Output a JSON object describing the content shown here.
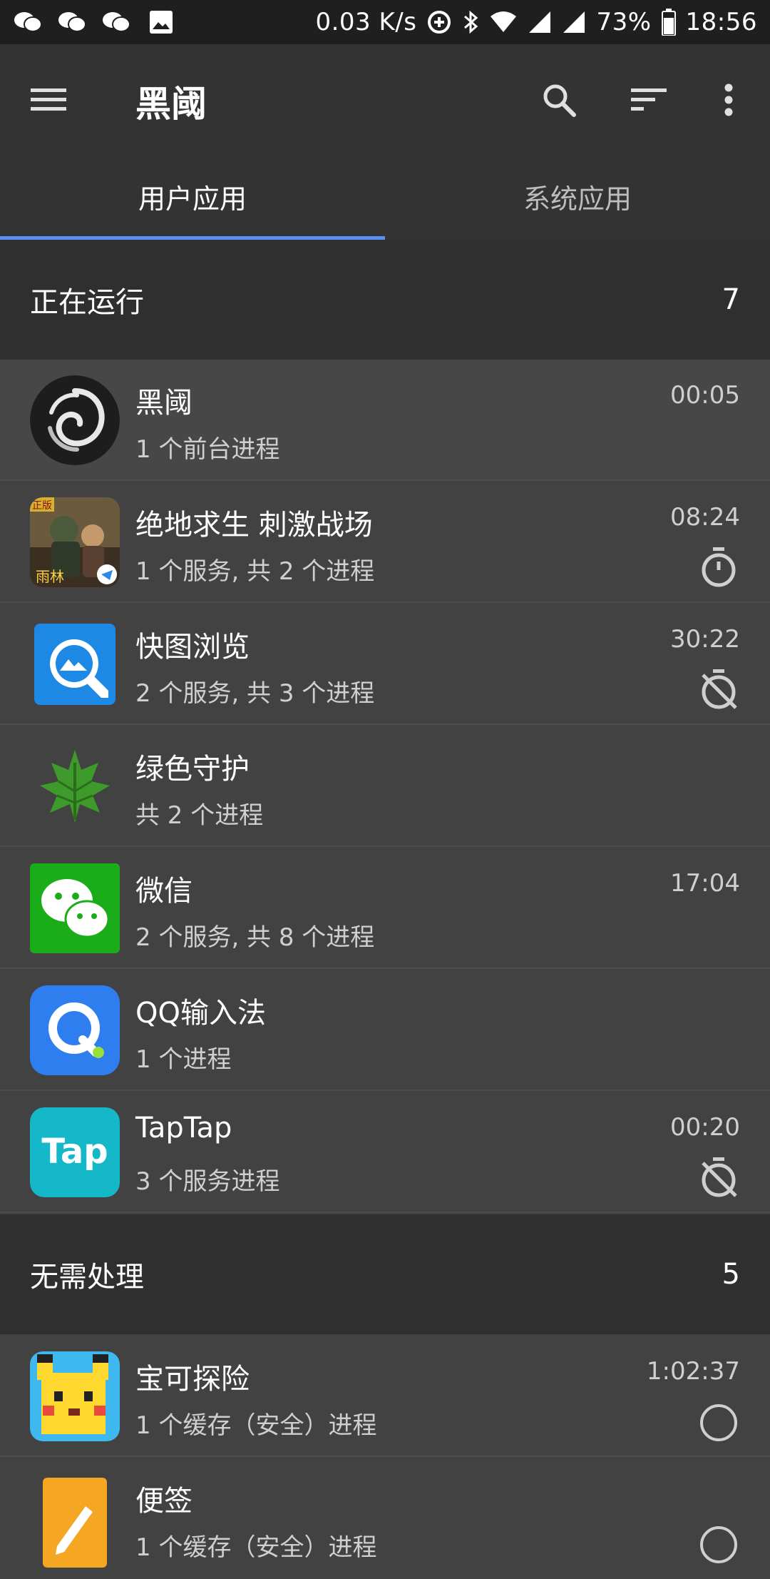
{
  "status_bar": {
    "network_speed": "0.03 K/s",
    "battery_percent": "73%",
    "time": "18:56"
  },
  "toolbar": {
    "title": "黑阈"
  },
  "tabs": [
    {
      "label": "用户应用",
      "active": true
    },
    {
      "label": "系统应用",
      "active": false
    }
  ],
  "sections": {
    "running": {
      "title": "正在运行",
      "count": "7"
    },
    "no_action": {
      "title": "无需处理",
      "count": "5"
    }
  },
  "apps": [
    {
      "name": "黑阈",
      "desc": "1 个前台进程",
      "time": "00:05",
      "status_icon": "none"
    },
    {
      "name": "绝地求生 刺激战场",
      "desc": "1 个服务, 共 2 个进程",
      "time": "08:24",
      "status_icon": "timer-icon"
    },
    {
      "name": "快图浏览",
      "desc": "2 个服务, 共 3 个进程",
      "time": "30:22",
      "status_icon": "timer-off-icon"
    },
    {
      "name": "绿色守护",
      "desc": "共 2 个进程",
      "time": "",
      "status_icon": "none"
    },
    {
      "name": "微信",
      "desc": "2 个服务, 共 8 个进程",
      "time": "17:04",
      "status_icon": "none"
    },
    {
      "name": "QQ输入法",
      "desc": "1 个进程",
      "time": "",
      "status_icon": "none"
    },
    {
      "name": "TapTap",
      "desc": "3 个服务进程",
      "time": "00:20",
      "status_icon": "timer-off-icon"
    },
    {
      "name": "宝可探险",
      "desc": "1 个缓存（安全）进程",
      "time": "1:02:37",
      "status_icon": "circle-icon"
    },
    {
      "name": "便签",
      "desc": "1 个缓存（安全）进程",
      "time": "",
      "status_icon": "circle-icon"
    }
  ],
  "icon_text": {
    "taptap": "Tap",
    "pubg_badge": "正版",
    "pubg_brand": "雨林"
  },
  "colors": {
    "accent": "#5c8ff0",
    "toolbar": "#333333",
    "list_bg": "#424242",
    "section_bg": "#2f2f2f"
  }
}
